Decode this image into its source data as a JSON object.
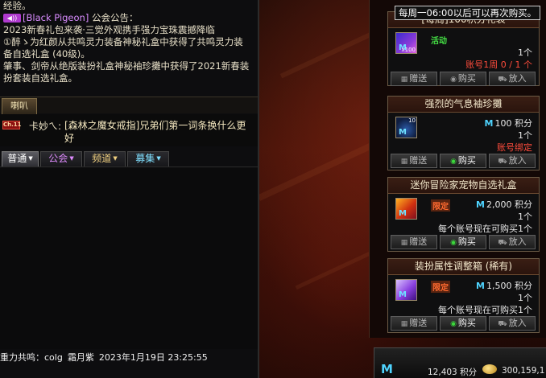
{
  "chat": {
    "lines": [
      "经验。",
      "[Black Pigeon] 公会公告：",
      "2023新春礼包来袭·三觉外观携手强力宝珠震撼降临",
      "①醉ゝ为红颜从共鸣灵力装备神秘礼盒中获得了共鸣灵力装",
      "备自选礼盒 (40级)。",
      "肇事、剑帝从绝版装扮礼盒神秘袖珍攤中获得了2021新春装",
      "扮套装自选礼盒。"
    ],
    "guild_badge": "◀))",
    "guild_name": "[Black Pigeon]",
    "guild_notice_suffix": " 公会公告：",
    "horn_tab": "喇叭",
    "horn_level": "Ch.11",
    "horn_user": "卡妙ㄟ:",
    "horn_text": "[森林之魔女戒指]兄弟们第一词条换什么更好",
    "tabs": {
      "normal": "普通",
      "guild": "公会",
      "channel": "频道",
      "recruit": "募集"
    },
    "fame": {
      "label": "重力共鸣：colg",
      "name": "霜月紫",
      "date": "2023年1月19日 23:25:55"
    }
  },
  "tooltip": "每周一06:00以后可以再次购买。",
  "shop": {
    "cards": [
      {
        "title": "[每周]100积分礼袋",
        "icon": "gift-bag-icon",
        "icon_count": "x100",
        "tag": "活动",
        "price": "",
        "qty": "1个",
        "note": "账号1周 0 / 1 个"
      },
      {
        "title": "强烈的气息袖珍攤",
        "icon": "fan-icon",
        "icon_count": "10",
        "tag": "",
        "price": "100 积分",
        "qty": "1个",
        "note": "账号绑定"
      },
      {
        "title": "迷你冒险家宠物自选礼盒",
        "icon": "chest-icon",
        "icon_count": "",
        "tag": "限定",
        "price": "2,000 积分",
        "qty": "1个",
        "note": "每个账号现在可购买1个"
      },
      {
        "title": "装扮属性调整箱 (稀有)",
        "icon": "cube-icon",
        "icon_count": "",
        "tag": "限定",
        "price": "1,500 积分",
        "qty": "1个",
        "note": "每个账号现在可购买1个"
      }
    ],
    "actions": {
      "gift": "赠送",
      "buy": "购买",
      "cart": "放入"
    },
    "currency": {
      "points_symbol": "M",
      "points": "12,403 积分",
      "gold": "300,159,1"
    }
  }
}
